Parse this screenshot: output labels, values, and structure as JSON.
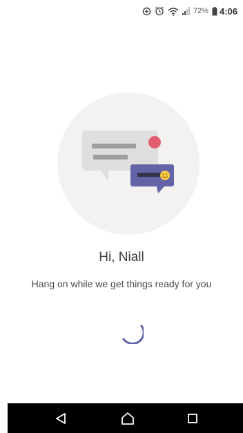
{
  "status_bar": {
    "battery_percent": "72%",
    "time": "4:06",
    "icons": [
      "data-saver-icon",
      "alarm-icon",
      "wifi-icon",
      "signal-icon",
      "battery-icon"
    ]
  },
  "loading": {
    "greeting": "Hi, Niall",
    "message": "Hang on while we get things ready for you"
  },
  "colors": {
    "accent": "#6264a7",
    "notification_dot": "#e05d6f",
    "circle_bg": "#f3f2f1",
    "card_gray": "#e1dfdd"
  },
  "nav_bar": {
    "buttons": [
      "back-icon",
      "home-icon",
      "recents-icon"
    ]
  }
}
